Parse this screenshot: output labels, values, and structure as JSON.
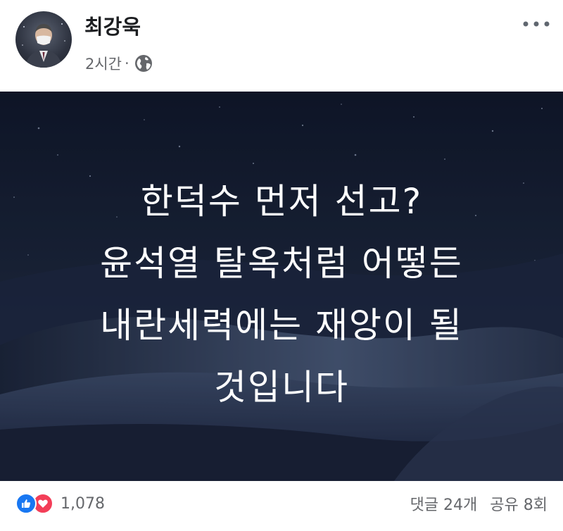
{
  "post": {
    "author": "최강욱",
    "time": "2시간",
    "separator": "·",
    "privacy_icon": "globe-icon",
    "more_icon": "more-dots-icon"
  },
  "image": {
    "lines": [
      "한덕수 먼저 선고?",
      "윤석열 탈옥처럼 어떻든",
      "내란세력에는 재앙이 될",
      "것입니다"
    ]
  },
  "footer": {
    "reaction_icons": [
      "like-icon",
      "love-icon"
    ],
    "reaction_count": "1,078",
    "comments": "댓글 24개",
    "shares": "공유 8회"
  },
  "colors": {
    "like": "#1877f2",
    "love": "#f33e58",
    "secondary_text": "#65676b",
    "primary_text": "#1c1e21",
    "image_bg": "#131b2e"
  }
}
